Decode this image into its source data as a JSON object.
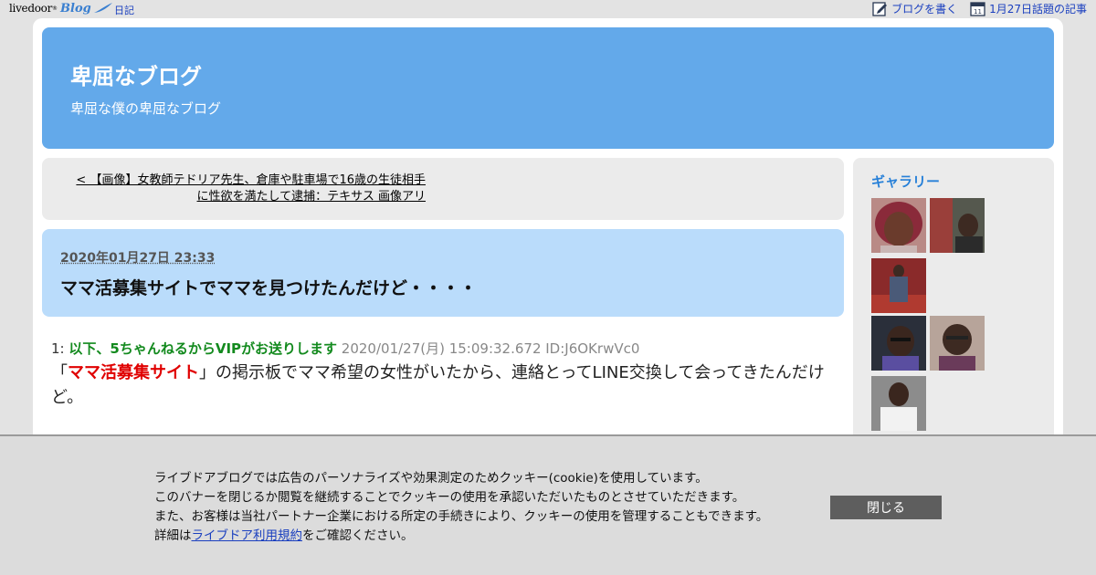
{
  "topbar": {
    "logo_text": "livedoor",
    "logo_sup": "®",
    "logo_blog": "Blog",
    "diary_link": "日記",
    "write_blog_link": "ブログを書く",
    "topic_link": "1月27日話題の記事",
    "calendar_day": "11"
  },
  "blog": {
    "title": "卑屈なブログ",
    "description": "卑屈な僕の卑屈なブログ"
  },
  "prev_article": {
    "line1": "< 【画像】女教師テドリア先生、倉庫や駐車場で16歳の生徒相手",
    "line2": "に性欲を満たして逮捕：テキサス 画像アリ"
  },
  "article": {
    "date": "2020年01月27日 23:33",
    "title": "ママ活募集サイトでママを見つけたんだけど・・・・",
    "post": {
      "number": "1:",
      "name": "以下、5ちゃんねるからVIPがお送りします",
      "meta": "2020/01/27(月) 15:09:32.672 ID:J6OKrwVc0",
      "body_open": "「",
      "body_highlight": "ママ活募集サイト",
      "body_rest": "」の掲示板でママ希望の女性がいたから、連絡とってLINE交換して会ってきたんだけど。"
    }
  },
  "sidebar": {
    "gallery_title": "ギャラリー",
    "thumbnails": [
      {
        "name": "gallery-thumb-1",
        "icon": "portrait-red-hair"
      },
      {
        "name": "gallery-thumb-2",
        "icon": "portrait-pair"
      },
      {
        "name": "gallery-thumb-3",
        "icon": "portrait-full-body"
      },
      {
        "name": "gallery-thumb-4",
        "icon": "portrait-glasses-car"
      },
      {
        "name": "gallery-thumb-5",
        "icon": "portrait-glasses"
      },
      {
        "name": "gallery-thumb-6",
        "icon": "portrait-white-shirt"
      }
    ]
  },
  "cookie": {
    "line1": "ライブドアブログでは広告のパーソナライズや効果測定のためクッキー(cookie)を使用しています。",
    "line2": "このバナーを閉じるか閲覧を継続することでクッキーの使用を承認いただいたものとさせていただきます。",
    "line3": "また、お客様は当社パートナー企業における所定の手続きにより、クッキーの使用を管理することもできます。",
    "line4_prefix": "詳細は",
    "line4_link": "ライブドア利用規約",
    "line4_suffix": "をご確認ください。",
    "close_button": "閉じる"
  },
  "colors": {
    "header_bg": "#63a9ea",
    "article_head_bg": "#badcfb",
    "poster_name": "#138a1e",
    "highlight_red": "#e00000",
    "gallery_title": "#2780d8",
    "link_blue": "#1a3fbf"
  }
}
